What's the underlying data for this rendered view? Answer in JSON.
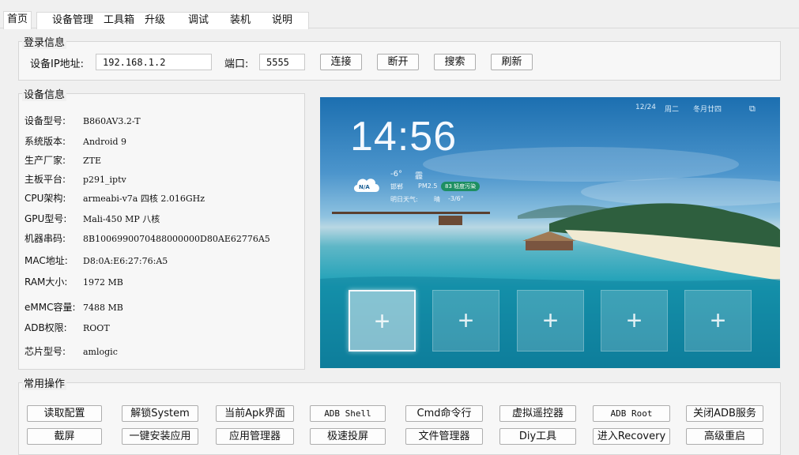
{
  "tabs": [
    "首页",
    "设备管理",
    "工具箱",
    "升级",
    "调试",
    "装机",
    "说明"
  ],
  "login": {
    "title": "登录信息",
    "ip_label": "设备IP地址:",
    "ip_value": "192.168.1.2",
    "port_label": "端口:",
    "port_value": "5555",
    "buttons": [
      "连接",
      "断开",
      "搜索",
      "刷新"
    ]
  },
  "device": {
    "title": "设备信息",
    "rows": [
      {
        "k": "设备型号:",
        "v": "B860AV3.2-T"
      },
      {
        "k": "系统版本:",
        "v": "Android 9"
      },
      {
        "k": "生产厂家:",
        "v": "ZTE"
      },
      {
        "k": "主板平台:",
        "v": "p291_iptv"
      },
      {
        "k": "CPU架构:",
        "v": "armeabi-v7a 四核 2.016GHz"
      },
      {
        "k": "GPU型号:",
        "v": "Mali-450 MP 八核"
      },
      {
        "k": "机器串码:",
        "v": "8B1006990070488000000D80AE62776A5"
      },
      {
        "k": "MAC地址:",
        "v": "D8:0A:E6:27:76:A5"
      },
      {
        "k": "RAM大小:",
        "v": "1972 MB"
      },
      {
        "k": "eMMC容量:",
        "v": "7488 MB"
      },
      {
        "k": "ADB权限:",
        "v": "ROOT"
      },
      {
        "k": "芯片型号:",
        "v": "amlogic"
      }
    ]
  },
  "preview": {
    "date": "12/24",
    "weekday": "周二",
    "lunar": "冬月廿四",
    "time": "14:56",
    "weather_icon": "N/A",
    "temp": "-6°",
    "condition": "霾",
    "city": "邯郸",
    "pm_label": "PM2.5",
    "pm_badge": "83 轻度污染",
    "tomorrow_label": "明日天气:",
    "tomorrow_condition": "晴",
    "tomorrow_temp": "-3/6°",
    "tiles": [
      "+",
      "+",
      "+",
      "+",
      "+"
    ]
  },
  "ops": {
    "title": "常用操作",
    "row1": [
      "读取配置",
      "解锁System",
      "当前Apk界面",
      "ADB Shell",
      "Cmd命令行",
      "虚拟遥控器",
      "ADB  Root",
      "关闭ADB服务"
    ],
    "row2": [
      "截屏",
      "一键安装应用",
      "应用管理器",
      "极速投屏",
      "文件管理器",
      "Diy工具",
      "进入Recovery",
      "高级重启"
    ]
  },
  "colors": {
    "window_bg": "#f0f0f0",
    "panel_bg": "#f7f7f7",
    "border": "#d6d6d6"
  }
}
